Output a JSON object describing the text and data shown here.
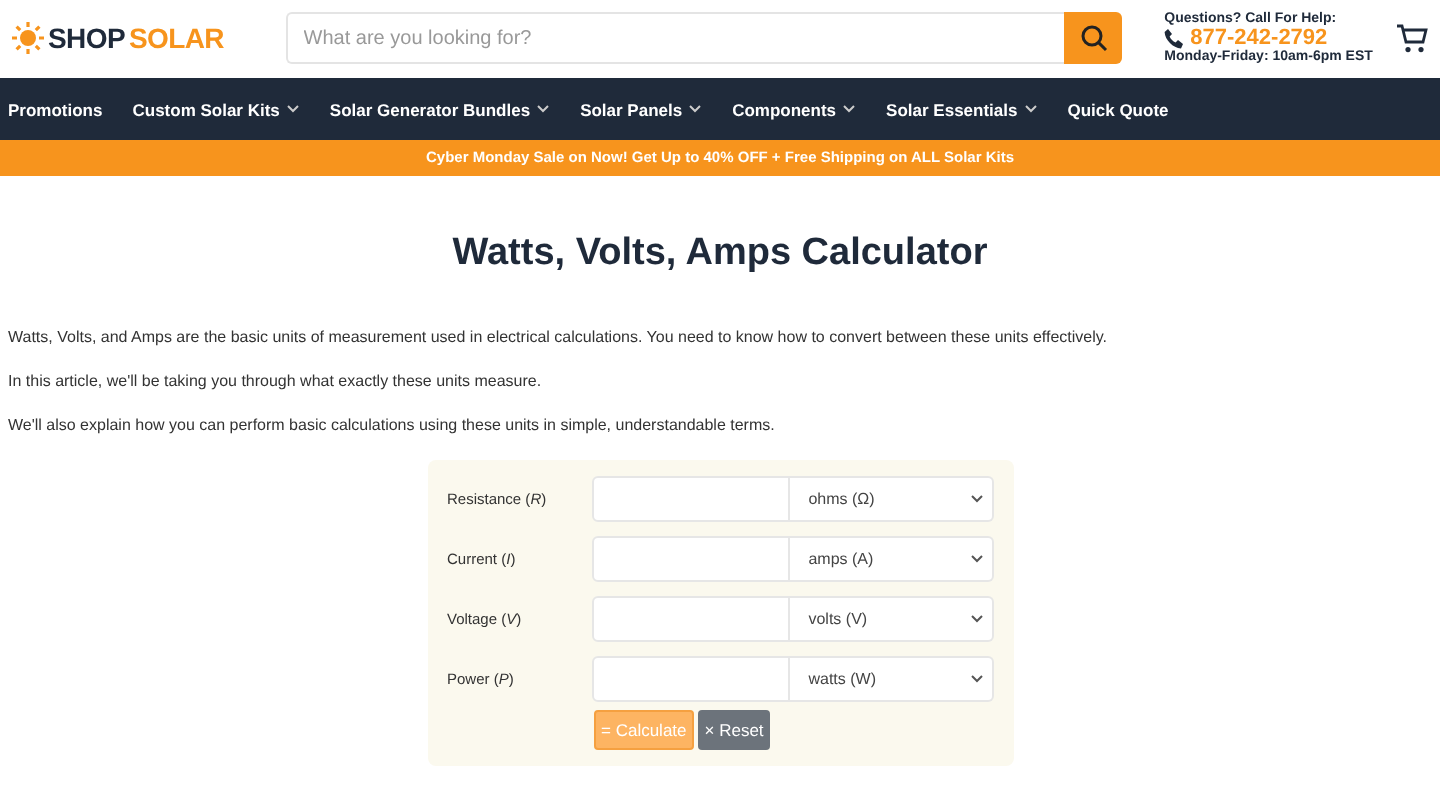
{
  "header": {
    "logo": {
      "part_1": "SHOP",
      "part_2": "SOLAR"
    },
    "search": {
      "placeholder": "What are you looking for?"
    },
    "help": {
      "heading": "Questions? Call For Help:",
      "phone": "877-242-2792",
      "hours": "Monday-Friday: 10am-6pm EST"
    }
  },
  "nav": [
    {
      "label": "Promotions",
      "has_menu": false
    },
    {
      "label": "Custom Solar Kits",
      "has_menu": true
    },
    {
      "label": "Solar Generator Bundles",
      "has_menu": true
    },
    {
      "label": "Solar Panels",
      "has_menu": true
    },
    {
      "label": "Components",
      "has_menu": true
    },
    {
      "label": "Solar Essentials",
      "has_menu": true
    },
    {
      "label": "Quick Quote",
      "has_menu": false
    }
  ],
  "promo_bar": "Cyber Monday Sale on Now! Get Up to 40% OFF + Free Shipping on ALL Solar Kits",
  "title": "Watts, Volts, Amps Calculator",
  "paragraphs": [
    "Watts, Volts, and Amps are the basic units of measurement used in electrical calculations. You need to know how to convert between these units effectively.",
    "In this article, we'll be taking you through what exactly these units measure.",
    "We'll also explain how you can perform basic calculations using these units in simple, understandable terms."
  ],
  "calculator": {
    "rows": [
      {
        "label": "Resistance (*R*)",
        "unit": "ohms (Ω)"
      },
      {
        "label": "Current (*I*)",
        "unit": "amps (A)"
      },
      {
        "label": "Voltage (*V*)",
        "unit": "volts (V)"
      },
      {
        "label": "Power (*P*)",
        "unit": "watts (W)"
      }
    ],
    "buttons": [
      {
        "label": "= Calculate",
        "kind": "primary"
      },
      {
        "label": "× Reset",
        "kind": "secondary"
      }
    ]
  }
}
